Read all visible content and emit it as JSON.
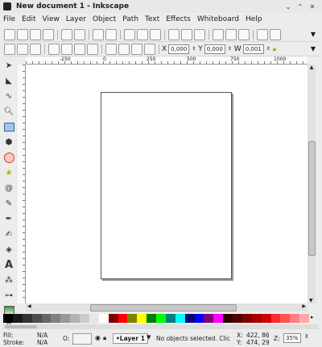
{
  "window": {
    "title": "New document 1 - Inkscape"
  },
  "menu": [
    "File",
    "Edit",
    "View",
    "Layer",
    "Object",
    "Path",
    "Text",
    "Effects",
    "Whiteboard",
    "Help"
  ],
  "ruler": {
    "ticks": [
      "-250",
      "0",
      "250",
      "500",
      "750",
      "1000"
    ]
  },
  "toolctrl": {
    "x_label": "X",
    "x_value": "0,000",
    "y_label": "Y",
    "y_value": "0,000",
    "w_label": "W",
    "w_value": "0,001"
  },
  "status": {
    "fill_label": "Fill:",
    "fill_value": "N/A",
    "stroke_label": "Stroke:",
    "stroke_value": "N/A",
    "opacity_label": "O:",
    "layer": "•Layer 1",
    "message": "No objects selected. Clic",
    "x_label": "X:",
    "x_coord": "422, 86",
    "y_label": "Y:",
    "y_coord": "474, 29",
    "zoom_label": "Z:",
    "zoom_value": "35%"
  },
  "palette_colors": [
    "#000000",
    "#1a1a1a",
    "#333333",
    "#4d4d4d",
    "#666666",
    "#808080",
    "#999999",
    "#b3b3b3",
    "#cccccc",
    "#e6e6e6",
    "#ffffff",
    "#800000",
    "#ff0000",
    "#808000",
    "#ffff00",
    "#008000",
    "#00ff00",
    "#008080",
    "#00ffff",
    "#000080",
    "#0000ff",
    "#800080",
    "#ff00ff",
    "#2b0000",
    "#550000",
    "#800000",
    "#aa0000",
    "#d40000",
    "#ff2a2a",
    "#ff5555",
    "#ff8080",
    "#ffaaaa"
  ]
}
